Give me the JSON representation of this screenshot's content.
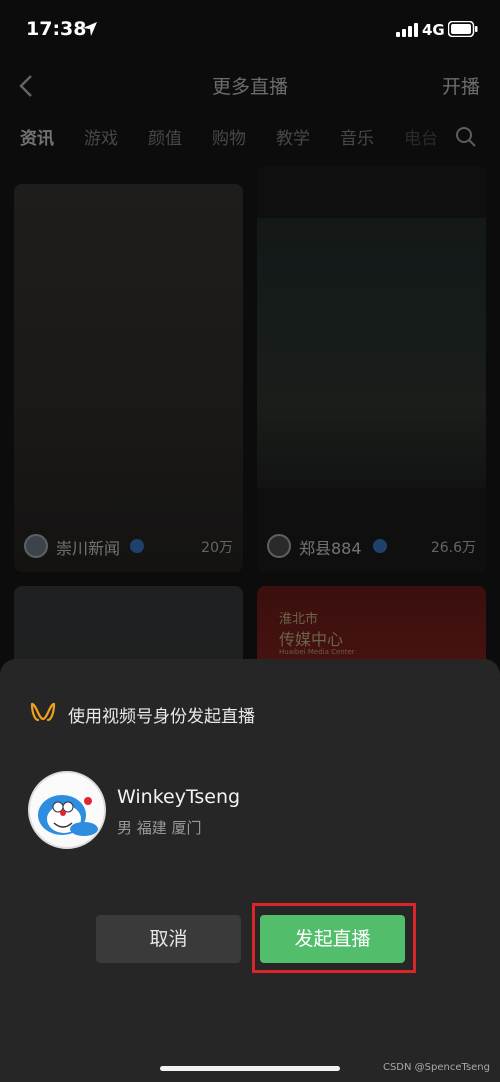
{
  "status_bar": {
    "time": "17:38",
    "network": "4G"
  },
  "nav": {
    "title": "更多直播",
    "action": "开播"
  },
  "tabs": [
    "资讯",
    "游戏",
    "颜值",
    "购物",
    "教学",
    "音乐",
    "电台"
  ],
  "cards": [
    {
      "name": "崇川新闻",
      "viewers": "20万"
    },
    {
      "name": "郑县884",
      "viewers": "26.6万"
    },
    {
      "brand_line1": "淮北市",
      "brand_line2": "传媒中心",
      "brand_line3": "Huaibei Media Center"
    }
  ],
  "sheet": {
    "title": "使用视频号身份发起直播",
    "user": {
      "name": "WinkeyTseng",
      "info": "男 福建 厦门"
    },
    "cancel_label": "取消",
    "start_label": "发起直播"
  },
  "watermark": "CSDN @SpenceTseng",
  "colors": {
    "accent_green": "#52bd6a",
    "highlight_red": "#d9262b",
    "sheet_bg": "#262626"
  }
}
